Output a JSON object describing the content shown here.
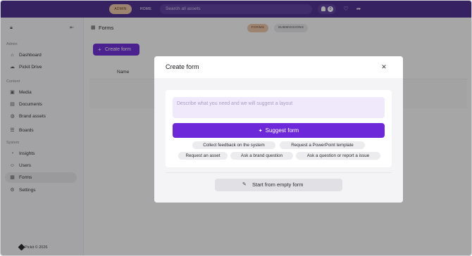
{
  "topbar": {
    "admin_label": "ADMIN",
    "home_label": "HOME",
    "search_placeholder": "Search all assets",
    "notification_count": "0"
  },
  "sidebar": {
    "sections": {
      "admin": "Admin",
      "content": "Content",
      "system": "System"
    },
    "items": [
      {
        "label": "Dashboard",
        "icon": "home-icon"
      },
      {
        "label": "Pickit Drive",
        "icon": "cloud-icon"
      },
      {
        "label": "Media",
        "icon": "image-icon"
      },
      {
        "label": "Documents",
        "icon": "document-icon"
      },
      {
        "label": "Brand assets",
        "icon": "palette-icon"
      },
      {
        "label": "Boards",
        "icon": "boards-icon"
      },
      {
        "label": "Insights",
        "icon": "insights-icon"
      },
      {
        "label": "Users",
        "icon": "users-icon"
      },
      {
        "label": "Forms",
        "icon": "forms-icon",
        "active": true
      },
      {
        "label": "Settings",
        "icon": "gear-icon"
      }
    ],
    "footer": "Pickit © 2026"
  },
  "main": {
    "page_title": "Forms",
    "tabs": [
      "FORMS",
      "SUBMISSIONS"
    ],
    "create_button": "Create form",
    "table_header_name": "Name"
  },
  "modal": {
    "title": "Create form",
    "prompt_placeholder": "Describe what you need and we will suggest a layout",
    "suggest_button": "Suggest form",
    "suggestions": [
      "Collect feedback on the system",
      "Request a PowerPoint template",
      "Request an asset",
      "Ask a brand question",
      "Ask a question or report a issue"
    ],
    "empty_button": "Start from empty form"
  },
  "colors": {
    "topbar": "#4c2a8e",
    "accent": "#6d28d9",
    "admin_pill": "#f1c9a8"
  }
}
